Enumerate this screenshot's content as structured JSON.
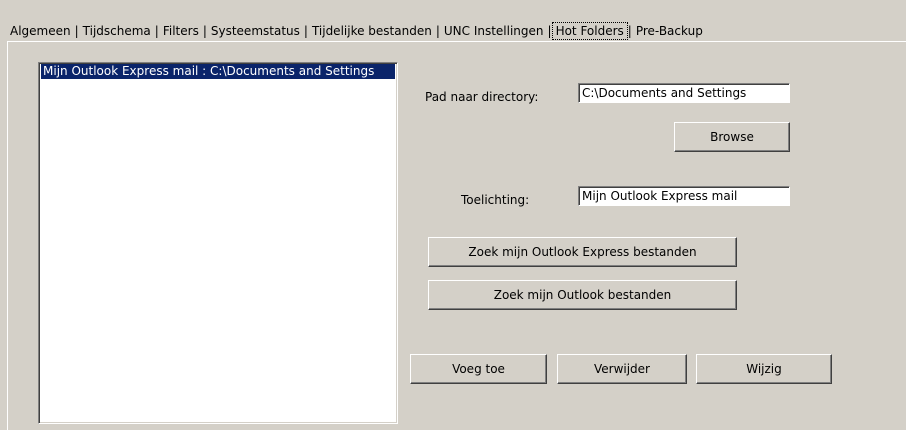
{
  "tabs": [
    {
      "label": "Algemeen",
      "active": false
    },
    {
      "label": "Tijdschema",
      "active": false
    },
    {
      "label": "Filters",
      "active": false
    },
    {
      "label": "Systeemstatus",
      "active": false
    },
    {
      "label": "Tijdelijke bestanden",
      "active": false
    },
    {
      "label": "UNC Instellingen",
      "active": false
    },
    {
      "label": "Hot Folders",
      "active": true
    },
    {
      "label": "Pre-Backup",
      "active": false
    }
  ],
  "folder_list": {
    "items": [
      "Mijn Outlook Express mail : C:\\Documents and Settings"
    ],
    "selected_index": 0
  },
  "form": {
    "path_label": "Pad naar directory:",
    "path_value": "C:\\Documents and Settings",
    "browse_label": "Browse",
    "note_label": "Toelichting:",
    "note_value": "Mijn Outlook Express mail",
    "find_oe_label": "Zoek mijn Outlook Express bestanden",
    "find_outlook_label": "Zoek mijn Outlook bestanden"
  },
  "actions": {
    "add_label": "Voeg toe",
    "remove_label": "Verwijder",
    "edit_label": "Wijzig"
  },
  "colors": {
    "background": "#d4d0c8",
    "selection": "#0a246a"
  }
}
